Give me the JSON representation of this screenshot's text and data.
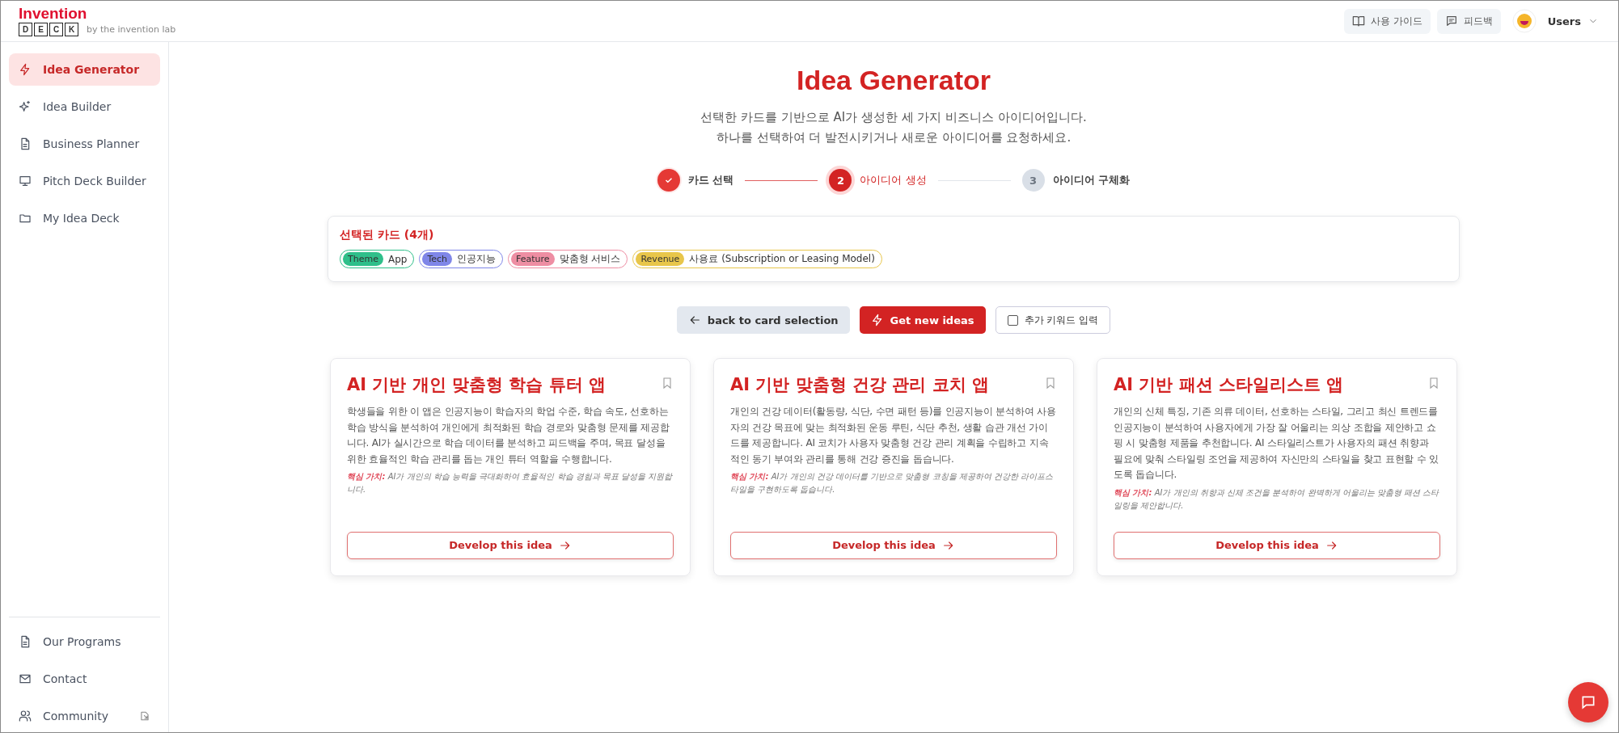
{
  "header": {
    "logo": {
      "word": "Invention",
      "letters": [
        "D",
        "E",
        "C",
        "K"
      ],
      "tagline": "by the invention lab"
    },
    "links": [
      {
        "label": "사용 가이드",
        "kind": "book"
      },
      {
        "label": "피드백",
        "kind": "chat"
      }
    ],
    "user": {
      "name": "Users"
    }
  },
  "sidebar": {
    "items": [
      {
        "label": "Idea Generator",
        "kind": "bolt",
        "selected": true
      },
      {
        "label": "Idea Builder",
        "kind": "sparkle",
        "selected": false
      },
      {
        "label": "Business Planner",
        "kind": "doc",
        "selected": false
      },
      {
        "label": "Pitch Deck Builder",
        "kind": "monitor",
        "selected": false
      },
      {
        "label": "My Idea Deck",
        "kind": "folder",
        "selected": false
      }
    ],
    "footer_items": [
      {
        "label": "Our Programs",
        "kind": "doc",
        "external": false
      },
      {
        "label": "Contact",
        "kind": "mail",
        "external": false
      },
      {
        "label": "Community",
        "kind": "users",
        "external": true
      }
    ]
  },
  "page": {
    "title": "Idea Generator",
    "subtitle": [
      "선택한 카드를 기반으로 AI가 생성한 세 가지 비즈니스 아이디어입니다.",
      "하나를 선택하여 더 발전시키거나 새로운 아이디어를 요청하세요."
    ]
  },
  "steps": [
    {
      "label": "카드 선택",
      "completed": true,
      "selected": false
    },
    {
      "number": "2",
      "label": "아이디어 생성",
      "completed": false,
      "selected": true
    },
    {
      "number": "3",
      "label": "아이디어 구체화",
      "completed": false,
      "selected": false
    }
  ],
  "selected_cards": {
    "title": "선택된 카드 (4개)",
    "chips": [
      {
        "tag": "Theme",
        "value": "App",
        "color": "#2fbf8a"
      },
      {
        "tag": "Tech",
        "value": "인공지능",
        "color": "#7f86e8"
      },
      {
        "tag": "Feature",
        "value": "맞춤형 서비스",
        "color": "#ee8ea3"
      },
      {
        "tag": "Revenue",
        "value": "사용료 (Subscription or Leasing Model)",
        "color": "#e8c64a"
      }
    ]
  },
  "actions": {
    "back": "back to card selection",
    "new_ideas": "Get new ideas",
    "keyword": {
      "label": "추가 키워드 입력",
      "checked": false
    }
  },
  "ideas": [
    {
      "title": "AI 기반 개인 맞춤형 학습 튜터 앱",
      "description": "학생들을 위한 이 앱은 인공지능이 학습자의 학업 수준, 학습 속도, 선호하는 학습 방식을 분석하여 개인에게 최적화된 학습 경로와 맞춤형 문제를 제공합니다. AI가 실시간으로 학습 데이터를 분석하고 피드백을 주며, 목표 달성을 위한 효율적인 학습 관리를 돕는 개인 튜터 역할을 수행합니다.",
      "core_label": "핵심 가치:",
      "core_value": "AI가 개인의 학습 능력을 극대화하여 효율적인 학습 경험과 목표 달성을 지원합니다.",
      "bookmarked": false,
      "action": "Develop this idea"
    },
    {
      "title": "AI 기반 맞춤형 건강 관리 코치 앱",
      "description": "개인의 건강 데이터(활동량, 식단, 수면 패턴 등)를 인공지능이 분석하여 사용자의 건강 목표에 맞는 최적화된 운동 루틴, 식단 추천, 생활 습관 개선 가이드를 제공합니다. AI 코치가 사용자 맞춤형 건강 관리 계획을 수립하고 지속적인 동기 부여와 관리를 통해 건강 증진을 돕습니다.",
      "core_label": "핵심 가치:",
      "core_value": "AI가 개인의 건강 데이터를 기반으로 맞춤형 코칭을 제공하여 건강한 라이프스타일을 구현하도록 돕습니다.",
      "bookmarked": false,
      "action": "Develop this idea"
    },
    {
      "title": "AI 기반 패션 스타일리스트 앱",
      "description": "개인의 신체 특징, 기존 의류 데이터, 선호하는 스타일, 그리고 최신 트렌드를 인공지능이 분석하여 사용자에게 가장 잘 어울리는 의상 조합을 제안하고 쇼핑 시 맞춤형 제품을 추천합니다. AI 스타일리스트가 사용자의 패션 취향과 필요에 맞춰 스타일링 조언을 제공하여 자신만의 스타일을 찾고 표현할 수 있도록 돕습니다.",
      "core_label": "핵심 가치:",
      "core_value": "AI가 개인의 취향과 신체 조건을 분석하여 완벽하게 어울리는 맞춤형 패션 스타일링을 제안합니다.",
      "bookmarked": false,
      "action": "Develop this idea"
    }
  ]
}
